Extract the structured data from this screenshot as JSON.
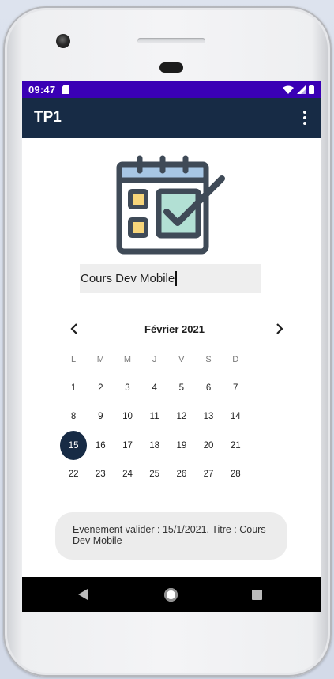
{
  "status_bar": {
    "time": "09:47",
    "icons": [
      "sd-card-icon",
      "wifi-icon",
      "signal-icon",
      "battery-icon"
    ],
    "color": "#3a00b5"
  },
  "app_bar": {
    "title": "TP1",
    "overflow_icon": "more-vert-icon",
    "color": "#172b45"
  },
  "illustration": {
    "icon": "calendar-check-icon"
  },
  "event_title_input": {
    "value": "Cours Dev Mobile"
  },
  "calendar": {
    "month_label": "Février 2021",
    "prev_icon": "chevron-left-icon",
    "next_icon": "chevron-right-icon",
    "weekdays": [
      "L",
      "M",
      "M",
      "J",
      "V",
      "S",
      "D"
    ],
    "weeks": [
      [
        "1",
        "2",
        "3",
        "4",
        "5",
        "6",
        "7"
      ],
      [
        "8",
        "9",
        "10",
        "11",
        "12",
        "13",
        "14"
      ],
      [
        "15",
        "16",
        "17",
        "18",
        "19",
        "20",
        "21"
      ],
      [
        "22",
        "23",
        "24",
        "25",
        "26",
        "27",
        "28"
      ]
    ],
    "selected_day": "15",
    "selected_color": "#172b45"
  },
  "toast": {
    "message": "Evenement valider : 15/1/2021, Titre : Cours Dev Mobile"
  },
  "nav_bar": {
    "icons": [
      "back-icon",
      "home-icon",
      "recents-icon"
    ]
  }
}
